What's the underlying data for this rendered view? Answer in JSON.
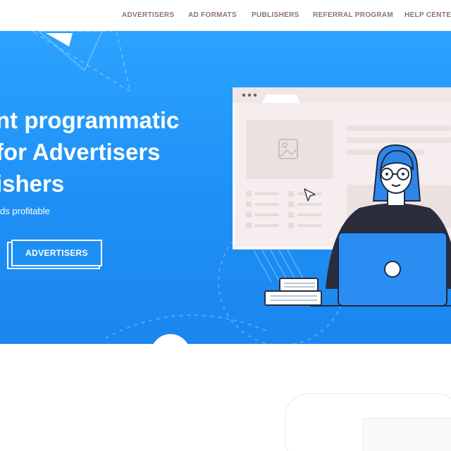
{
  "nav": {
    "items": [
      {
        "label": "ADVERTISERS"
      },
      {
        "label": "AD FORMATS"
      },
      {
        "label": "PUBLISHERS"
      },
      {
        "label": "REFERRAL PROGRAM"
      },
      {
        "label": "HELP CENTER"
      }
    ]
  },
  "hero": {
    "headline": [
      "nt programmatic",
      "for Advertisers",
      "ishers"
    ],
    "subline": "ds profitable",
    "cta_label": "ADVERTISERS"
  },
  "colors": {
    "hero_blue": "#1e90f5",
    "nav_text": "#8a7474",
    "laptop_blue": "#2a8df2",
    "panel_pink": "#f1e6e6"
  }
}
